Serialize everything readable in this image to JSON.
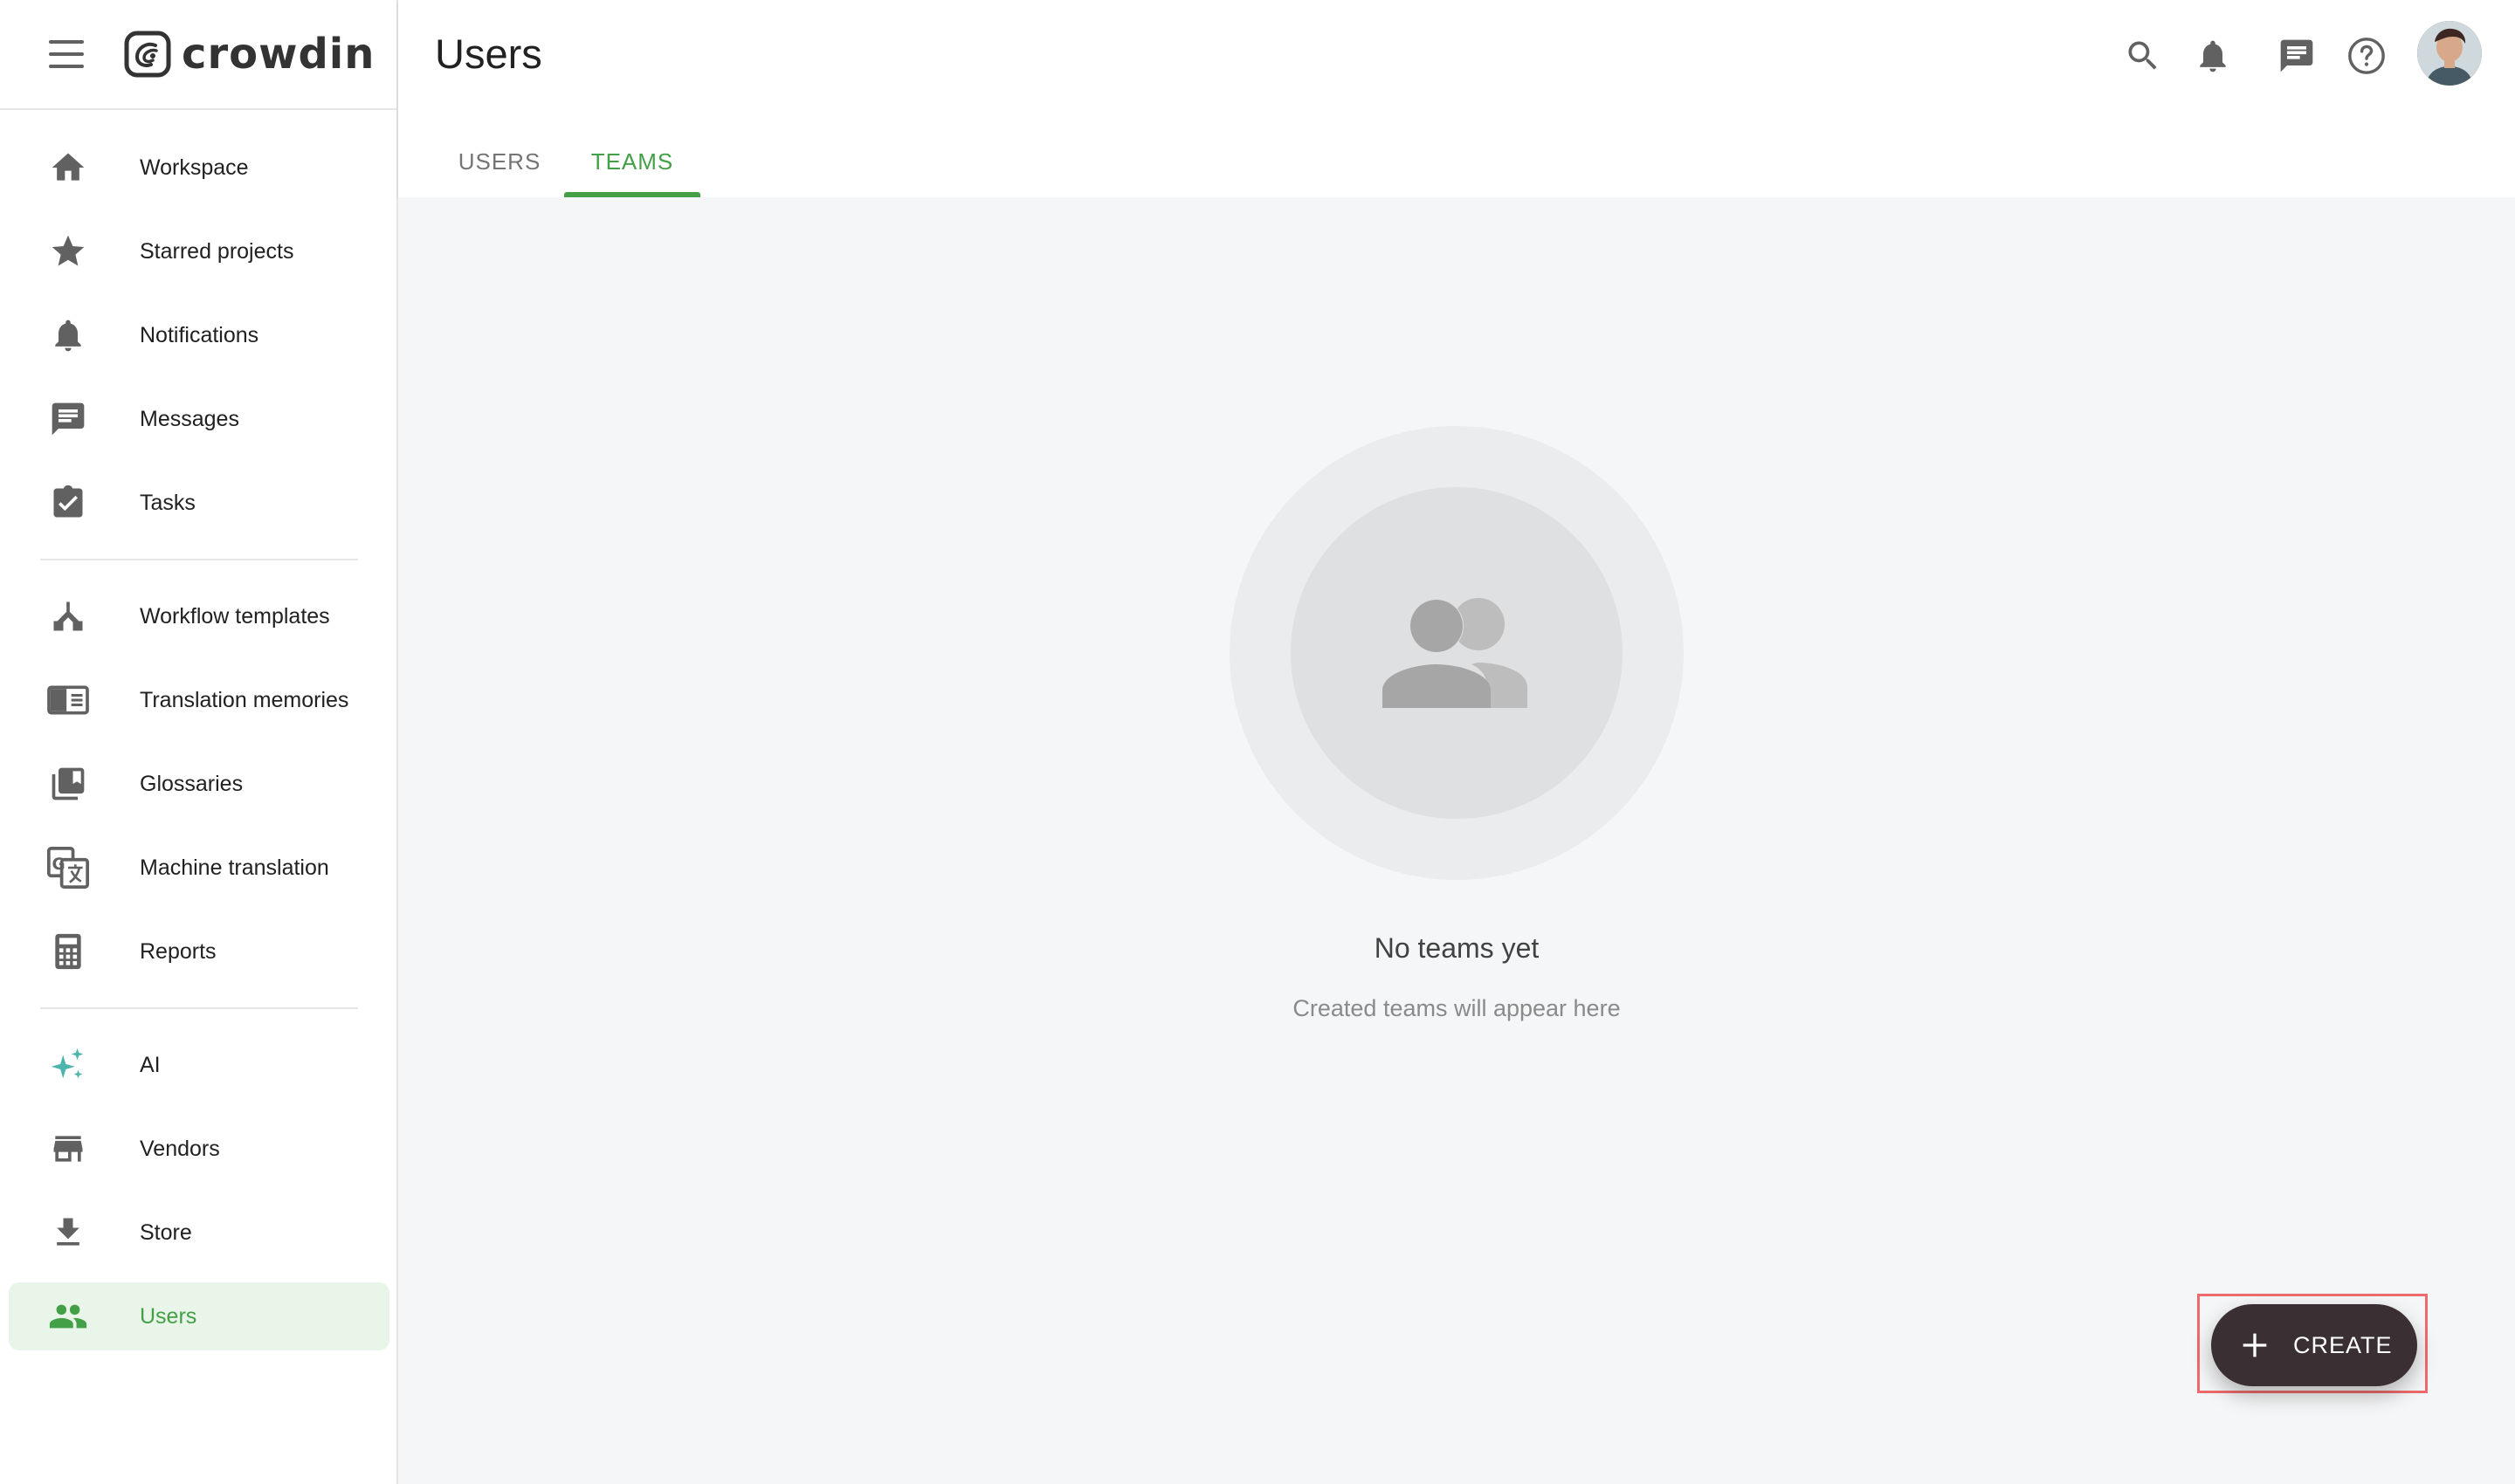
{
  "app": {
    "name": "crowdin"
  },
  "sidebar": {
    "items": [
      {
        "id": "workspace",
        "label": "Workspace",
        "icon": "home-icon"
      },
      {
        "id": "starred",
        "label": "Starred projects",
        "icon": "star-icon"
      },
      {
        "id": "notifications",
        "label": "Notifications",
        "icon": "bell-icon"
      },
      {
        "id": "messages",
        "label": "Messages",
        "icon": "message-icon"
      },
      {
        "id": "tasks",
        "label": "Tasks",
        "icon": "clipboard-check-icon"
      },
      {
        "id": "workflow",
        "label": "Workflow templates",
        "icon": "workflow-icon"
      },
      {
        "id": "tm",
        "label": "Translation memories",
        "icon": "book-open-icon"
      },
      {
        "id": "glossaries",
        "label": "Glossaries",
        "icon": "library-icon"
      },
      {
        "id": "mt",
        "label": "Machine translation",
        "icon": "translate-icon"
      },
      {
        "id": "reports",
        "label": "Reports",
        "icon": "calculator-icon"
      },
      {
        "id": "ai",
        "label": "AI",
        "icon": "sparkle-icon"
      },
      {
        "id": "vendors",
        "label": "Vendors",
        "icon": "store-icon"
      },
      {
        "id": "store",
        "label": "Store",
        "icon": "download-icon"
      },
      {
        "id": "users",
        "label": "Users",
        "icon": "users-icon",
        "active": true
      }
    ]
  },
  "header": {
    "title": "Users",
    "tabs": [
      {
        "label": "USERS",
        "active": false
      },
      {
        "label": "TEAMS",
        "active": true
      }
    ],
    "icons": [
      "search-icon",
      "bell-icon",
      "chat-icon",
      "help-icon"
    ]
  },
  "empty_state": {
    "title": "No teams yet",
    "subtitle": "Created teams will appear here"
  },
  "fab": {
    "label": "CREATE"
  },
  "colors": {
    "accent": "#43a047",
    "active_bg": "#e9f5e9",
    "fab_bg": "#3a2f33",
    "content_bg": "#f5f6f7",
    "highlight": "#ef6b6b"
  }
}
